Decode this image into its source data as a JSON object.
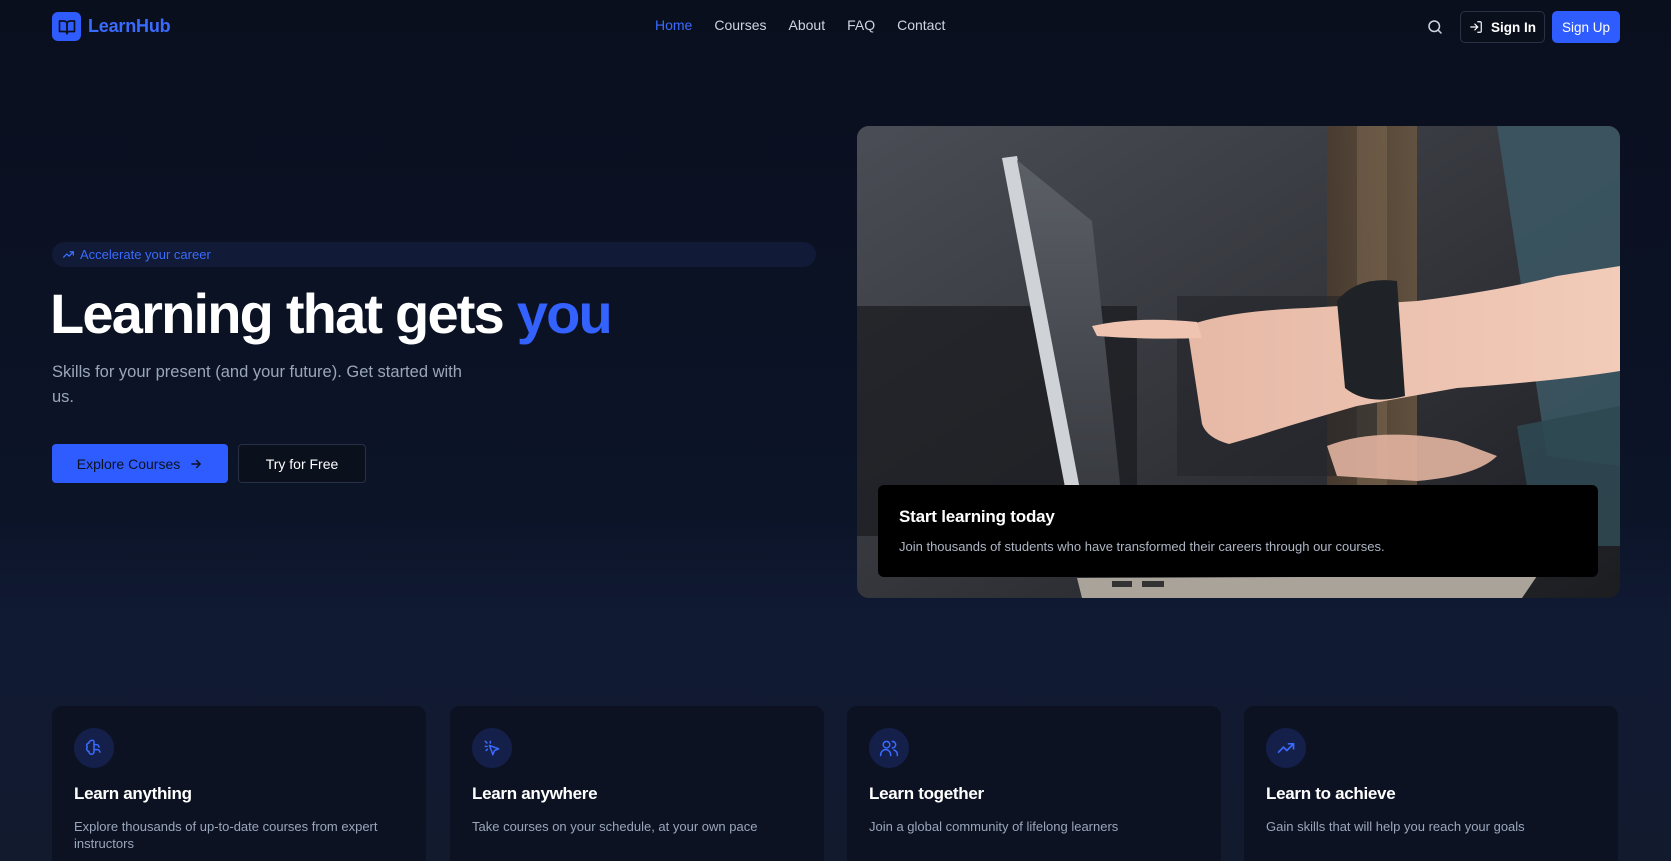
{
  "brand": {
    "name": "LearnHub",
    "accent": "#2f5cff"
  },
  "nav": {
    "links": [
      {
        "label": "Home",
        "active": true
      },
      {
        "label": "Courses",
        "active": false
      },
      {
        "label": "About",
        "active": false
      },
      {
        "label": "FAQ",
        "active": false
      },
      {
        "label": "Contact",
        "active": false
      }
    ],
    "search_icon": "search-icon",
    "sign_in": "Sign In",
    "sign_up": "Sign Up"
  },
  "hero": {
    "badge": "Accelerate your career",
    "title_main": "Learning that gets ",
    "title_accent": "you",
    "subtitle": "Skills for your present (and your future). Get started with us.",
    "primary_cta": "Explore Courses",
    "secondary_cta": "Try for Free",
    "image_card": {
      "title": "Start learning today",
      "text": "Join thousands of students who have transformed their careers through our courses."
    }
  },
  "features": [
    {
      "icon": "brain-icon",
      "title": "Learn anything",
      "text": "Explore thousands of up-to-date courses from expert instructors"
    },
    {
      "icon": "pointer-click-icon",
      "title": "Learn anywhere",
      "text": "Take courses on your schedule, at your own pace"
    },
    {
      "icon": "users-icon",
      "title": "Learn together",
      "text": "Join a global community of lifelong learners"
    },
    {
      "icon": "trending-up-icon",
      "title": "Learn to achieve",
      "text": "Gain skills that will help you reach your goals"
    }
  ]
}
